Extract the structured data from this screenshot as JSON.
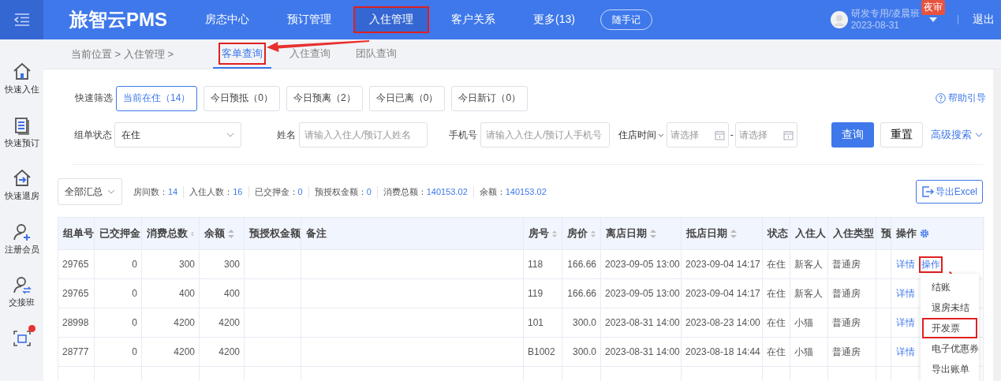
{
  "header": {
    "logo": "旅智云PMS",
    "nav": [
      {
        "label": "房态中心",
        "selected": false,
        "highlighted": false
      },
      {
        "label": "预订管理",
        "selected": false,
        "highlighted": false
      },
      {
        "label": "入住管理",
        "selected": true,
        "highlighted": true
      },
      {
        "label": "客户关系",
        "selected": false,
        "highlighted": false
      },
      {
        "label": "更多(13)",
        "selected": false,
        "highlighted": false
      }
    ],
    "note_button": "随手记",
    "user": {
      "name": "研发专用/凌晨班",
      "date": "2023-08-31",
      "badge": "夜审"
    },
    "logout": "退出"
  },
  "sidebar": [
    {
      "kind": "home",
      "label": "快速入住"
    },
    {
      "kind": "booking",
      "label": "快速预订"
    },
    {
      "kind": "checkout",
      "label": "快速退房"
    },
    {
      "kind": "member",
      "label": "注册会员"
    },
    {
      "kind": "shift",
      "label": "交接班"
    },
    {
      "kind": "share",
      "notification": true
    }
  ],
  "breadcrumb": "当前位置 > 入住管理 >",
  "subtabs": [
    {
      "label": "客单查询",
      "selected": true,
      "highlighted": true
    },
    {
      "label": "入住查询",
      "selected": false,
      "highlighted": false
    },
    {
      "label": "团队查询",
      "selected": false,
      "highlighted": false
    }
  ],
  "quick_filter": {
    "label": "快速筛选",
    "options": [
      {
        "label": "当前在住（14）",
        "selected": true
      },
      {
        "label": "今日预抵（0）",
        "selected": false
      },
      {
        "label": "今日预离（2）",
        "selected": false
      },
      {
        "label": "今日已离（0）",
        "selected": false
      },
      {
        "label": "今日新订（0）",
        "selected": false
      }
    ]
  },
  "help": "帮助引导",
  "form": {
    "status": {
      "label": "组单状态",
      "value": "在住"
    },
    "name": {
      "label": "姓名",
      "placeholder": "请输入入住人/预订人姓名"
    },
    "phone": {
      "label": "手机号",
      "placeholder": "请输入入住人/预订人手机号"
    },
    "stay_time": {
      "label": "住店时间",
      "start_placeholder": "请选择",
      "separator": "-",
      "end_placeholder": "请选择"
    },
    "query": "查询",
    "reset": "重置",
    "advanced": "高级搜索"
  },
  "summary": {
    "scope": "全部汇总",
    "stats": [
      {
        "label": "房间数：",
        "value": "14"
      },
      {
        "label": "入住人数：",
        "value": "16"
      },
      {
        "label": "已交押金：",
        "value": "0"
      },
      {
        "label": "预授权金额：",
        "value": "0"
      },
      {
        "label": "消费总额：",
        "value": "140153.02"
      },
      {
        "label": "余额：",
        "value": "140153.02"
      }
    ],
    "export": "导出Excel"
  },
  "table": {
    "columns": [
      {
        "label": "组单号"
      },
      {
        "label": "已交押金"
      },
      {
        "label": "消费总数",
        "sortable": true
      },
      {
        "label": "余额",
        "sortable": true
      },
      {
        "label": "预授权金额"
      },
      {
        "label": "备注"
      },
      {
        "label": "房号",
        "sortable": true
      },
      {
        "label": "房价",
        "sortable": true
      },
      {
        "label": "离店日期",
        "sortable": true
      },
      {
        "label": "抵店日期",
        "sortable": true
      },
      {
        "label": "状态"
      },
      {
        "label": "入住人"
      },
      {
        "label": "入住类型"
      },
      {
        "label": "预"
      },
      {
        "label": "操作"
      }
    ],
    "rows": [
      {
        "cells": [
          "29765",
          "0",
          "300",
          "300",
          null,
          null,
          "118",
          "166.66",
          "2023-09-05 13:00",
          "2023-09-04 14:17",
          "在住",
          "新客人",
          "普通房",
          null
        ],
        "actions": [
          {
            "label": "详情",
            "highlighted": false
          },
          {
            "label": "操作",
            "highlighted": true
          }
        ]
      },
      {
        "cells": [
          "29765",
          "0",
          "400",
          "400",
          null,
          null,
          "119",
          "166.66",
          "2023-09-05 13:00",
          "2023-09-04 14:17",
          "在住",
          "新客人",
          "普通房",
          null
        ],
        "actions": [
          {
            "label": "详情",
            "highlighted": false
          }
        ]
      },
      {
        "cells": [
          "28998",
          "0",
          "4200",
          "4200",
          null,
          null,
          "101",
          "300.0",
          "2023-08-31 14:00",
          "2023-08-23 14:00",
          "在住",
          "小猫",
          "普通房",
          null
        ],
        "actions": [
          {
            "label": "详情",
            "highlighted": false
          }
        ]
      },
      {
        "cells": [
          "28777",
          "0",
          "4200",
          "4200",
          null,
          null,
          "B1002",
          "300.0",
          "2023-08-31 14:00",
          "2023-08-18 14:44",
          "在住",
          "小猫",
          "普通房",
          null
        ],
        "actions": [
          {
            "label": "详情",
            "highlighted": false
          }
        ]
      }
    ],
    "action_menu": [
      {
        "label": "结账",
        "highlighted": false
      },
      {
        "label": "退房未结",
        "highlighted": false
      },
      {
        "label": "开发票",
        "highlighted": true
      },
      {
        "label": "电子优惠券",
        "highlighted": false
      },
      {
        "label": "导出账单",
        "highlighted": false
      }
    ]
  }
}
